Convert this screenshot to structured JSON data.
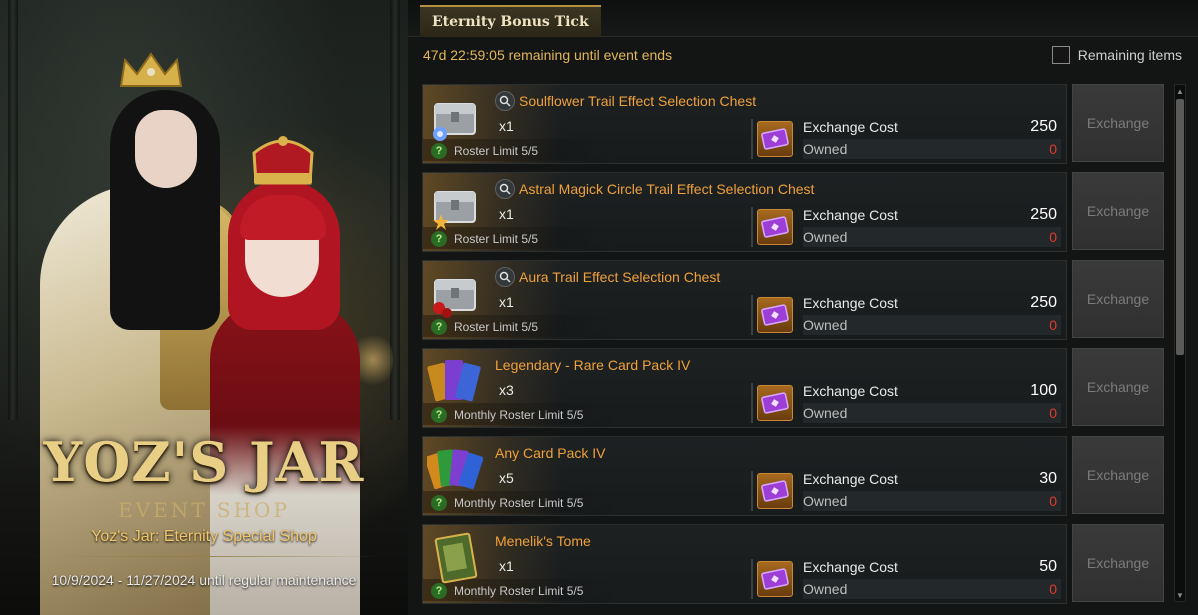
{
  "banner": {
    "title": "YOZ'S JAR",
    "subtitle": "EVENT SHOP",
    "shop_name": "Yoz's Jar: Eternity Special Shop",
    "dates": "10/9/2024 - 11/27/2024 until regular maintenance"
  },
  "panel": {
    "tab_label": "Eternity Bonus Tick",
    "timer": "47d 22:59:05 remaining until event ends",
    "remaining_items_label": "Remaining items",
    "remaining_items_checked": false
  },
  "items": [
    {
      "name": "Soulflower Trail Effect Selection Chest",
      "qty": "x1",
      "limit": "Roster Limit 5/5",
      "cost_label": "Exchange Cost",
      "cost": "250",
      "owned_label": "Owned",
      "owned": "0",
      "button": "Exchange",
      "icon": "silver-chest-flower-icon",
      "has_preview": true
    },
    {
      "name": "Astral Magick Circle Trail Effect Selection Chest",
      "qty": "x1",
      "limit": "Roster Limit 5/5",
      "cost_label": "Exchange Cost",
      "cost": "250",
      "owned_label": "Owned",
      "owned": "0",
      "button": "Exchange",
      "icon": "silver-chest-star-icon",
      "has_preview": true
    },
    {
      "name": "Aura Trail Effect Selection Chest",
      "qty": "x1",
      "limit": "Roster Limit 5/5",
      "cost_label": "Exchange Cost",
      "cost": "250",
      "owned_label": "Owned",
      "owned": "0",
      "button": "Exchange",
      "icon": "silver-chest-rose-icon",
      "has_preview": true
    },
    {
      "name": "Legendary - Rare Card Pack IV",
      "qty": "x3",
      "limit": "Monthly Roster Limit 5/5",
      "cost_label": "Exchange Cost",
      "cost": "100",
      "owned_label": "Owned",
      "owned": "0",
      "button": "Exchange",
      "icon": "card-pack-legendary-icon",
      "has_preview": false
    },
    {
      "name": "Any Card Pack IV",
      "qty": "x5",
      "limit": "Monthly Roster Limit 5/5",
      "cost_label": "Exchange Cost",
      "cost": "30",
      "owned_label": "Owned",
      "owned": "0",
      "button": "Exchange",
      "icon": "card-pack-any-icon",
      "has_preview": false
    },
    {
      "name": "Menelik's Tome",
      "qty": "x1",
      "limit": "Monthly Roster Limit 5/5",
      "cost_label": "Exchange Cost",
      "cost": "50",
      "owned_label": "Owned",
      "owned": "0",
      "button": "Exchange",
      "icon": "tome-icon",
      "has_preview": false
    }
  ],
  "colors": {
    "accent_gold": "#f0a13a",
    "timer": "#e3b659",
    "owned_red": "#e23a2a",
    "button_disabled_text": "#7c7c7c"
  },
  "scrollbar": {
    "up_icon": "triangle-up-icon",
    "down_icon": "triangle-down-icon"
  }
}
